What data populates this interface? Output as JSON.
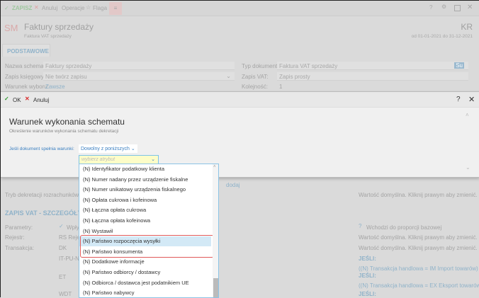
{
  "toolbar": {
    "save": "ZAPISZ",
    "cancel": "Anuluj",
    "operations": "Operacje",
    "flag": "Flaga"
  },
  "header": {
    "logo": "SM",
    "title": "Faktury sprzedaży",
    "subtitle": "Faktura VAT sprzedaży",
    "code": "KR",
    "period": "od 01-01-2021 do 31-12-2021"
  },
  "tab": "PODSTAWOWE",
  "form": {
    "name_label": "Nazwa schematu:",
    "name_value": "Faktury sprzedaży",
    "doctype_label": "Typ dokumentu:",
    "doctype_value": "Faktura VAT sprzedaży",
    "doctype_badge": "Su",
    "entry_label": "Zapis księgowy:",
    "entry_value": "Nie twórz zapisu",
    "vat_label": "Zapis VAT:",
    "vat_value": "Zapis prosty",
    "cond_label": "Warunek wyboru:",
    "cond_value": "Zawsze",
    "order_label": "Kolejność:",
    "order_value": "1"
  },
  "modal": {
    "ok": "OK",
    "cancel": "Anuluj",
    "help": "?",
    "title": "Warunek wykonania schematu",
    "subtitle": "Określenie warunków wykonania schematu dekretacji",
    "condition_label": "Jeśli dokument spełnia warunki:",
    "condition_value": "Dowolny z poniższych",
    "attr_placeholder": "wybierz atrybut"
  },
  "dropdown": {
    "items": [
      "(N) Identyfikator podatkowy klienta",
      "(N) Numer nadany przez urządzenie fiskalne",
      "(N) Numer unikatowy urządzenia fiskalnego",
      "(N) Opłata cukrowa i kofeinowa",
      "(N) Łączna opłata cukrowa",
      "(N) Łączna opłata kofeinowa",
      "(N) Wystawił",
      "(N) Państwo rozpoczęcia wysyłki",
      "(N) Państwo konsumenta",
      "(N) Dodatkowe informacje",
      "(N) Państwo odbiorcy / dostawcy",
      "(N) Odbiorca / dostawca jest podatnikiem UE",
      "(N) Państwo nabywcy"
    ],
    "selected_index": 7
  },
  "lower": {
    "add": "dodaj",
    "settlement_label": "Tryb dekretacji rozrachunków:",
    "default_hint": "Wartość domyślna. Kliknij prawym aby zmienić.",
    "section": "ZAPIS VAT - SZCZEGÓŁY",
    "params_label": "Parametry:",
    "params_value": "Wpły",
    "base_ratio": "Wchodzi do proporcji bazowej",
    "register_label": "Rejestr:",
    "register_value": "RS  Rejes",
    "transaction_label": "Transakcja:",
    "transaction_value": "DK",
    "rows": [
      {
        "code": "IT-PU-N",
        "if": "JEŚLI:",
        "cond": "((N) Transakcja handlowa = IM Import towarów)"
      },
      {
        "code": "ET",
        "if": "JEŚLI:",
        "cond": "((N) Transakcja handlowa = EX Eksport towarów)"
      },
      {
        "code": "WDT",
        "if": "JEŚLI:",
        "cond": ""
      }
    ]
  }
}
